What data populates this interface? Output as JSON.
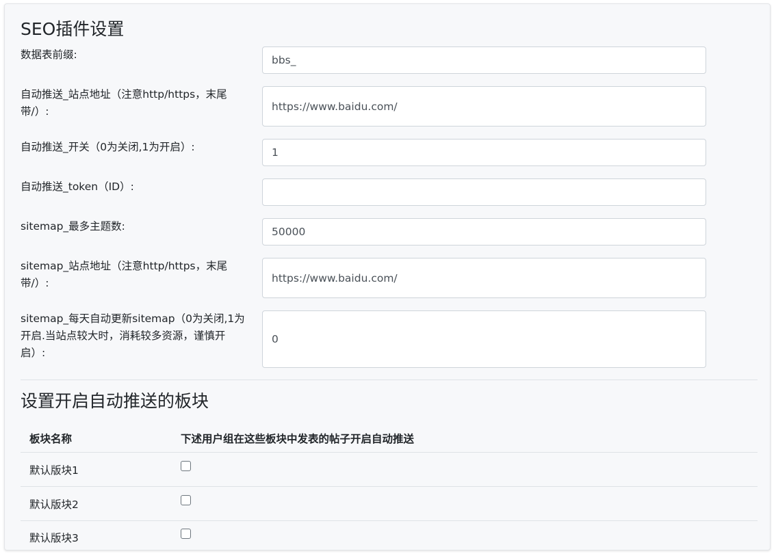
{
  "seo_settings": {
    "title": "SEO插件设置",
    "fields": [
      {
        "label": "数据表前缀:",
        "value": "bbs_"
      },
      {
        "label": "自动推送_站点地址（注意http/https，末尾带/）:",
        "value": "https://www.baidu.com/"
      },
      {
        "label": "自动推送_开关（0为关闭,1为开启）:",
        "value": "1"
      },
      {
        "label": "自动推送_token（ID）:",
        "value": ""
      },
      {
        "label": "sitemap_最多主题数:",
        "value": "50000"
      },
      {
        "label": "sitemap_站点地址（注意http/https，末尾带/）:",
        "value": "https://www.baidu.com/"
      },
      {
        "label": "sitemap_每天自动更新sitemap（0为关闭,1为开启.当站点较大时，消耗较多资源，谨慎开启）:",
        "value": "0"
      }
    ]
  },
  "auto_push_forums": {
    "title": "设置开启自动推送的板块",
    "columns": [
      "板块名称",
      "下述用户组在这些板块中发表的帖子开启自动推送"
    ],
    "rows": [
      {
        "name": "默认版块1",
        "checked": false
      },
      {
        "name": "默认版块2",
        "checked": false
      },
      {
        "name": "默认版块3",
        "checked": false
      }
    ]
  }
}
